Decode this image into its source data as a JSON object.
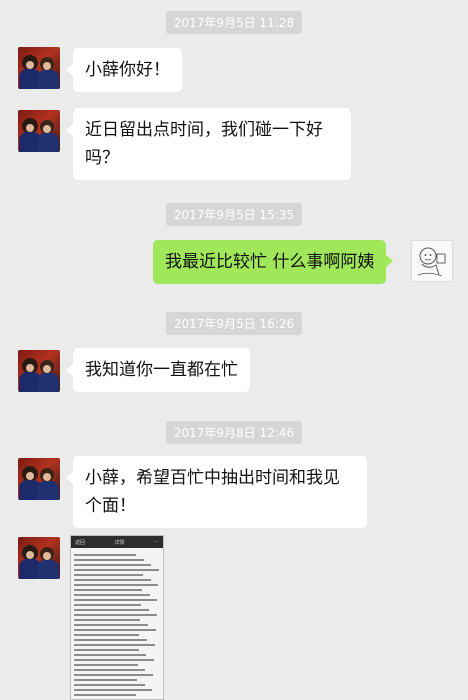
{
  "timestamps": [
    "2017年9月5日 11:28",
    "2017年9月5日 15:35",
    "2017年9月5日 16:26",
    "2017年9月8日 12:46"
  ],
  "messages": [
    {
      "text": "小薛你好！"
    },
    {
      "text_line1": "近日留出点时间，我们碰一下好",
      "text_line2": "吗？"
    },
    {
      "text": "我最近比较忙 什么事啊阿姨"
    },
    {
      "text": "我知道你一直都在忙"
    },
    {
      "text_line1": "小薛，希望百忙中抽出时间和我见",
      "text_line2": "个面！"
    }
  ],
  "document_image": {
    "bar_left": "返回",
    "bar_center": "详情"
  },
  "colors": {
    "background": "#ebebeb",
    "bubble_in": "#ffffff",
    "bubble_out": "#a0e75a",
    "timestamp_bg": "#d6d6d6"
  },
  "icons": {
    "contact_avatar": "photo-of-two-people",
    "my_avatar": "cartoon-sketch"
  }
}
